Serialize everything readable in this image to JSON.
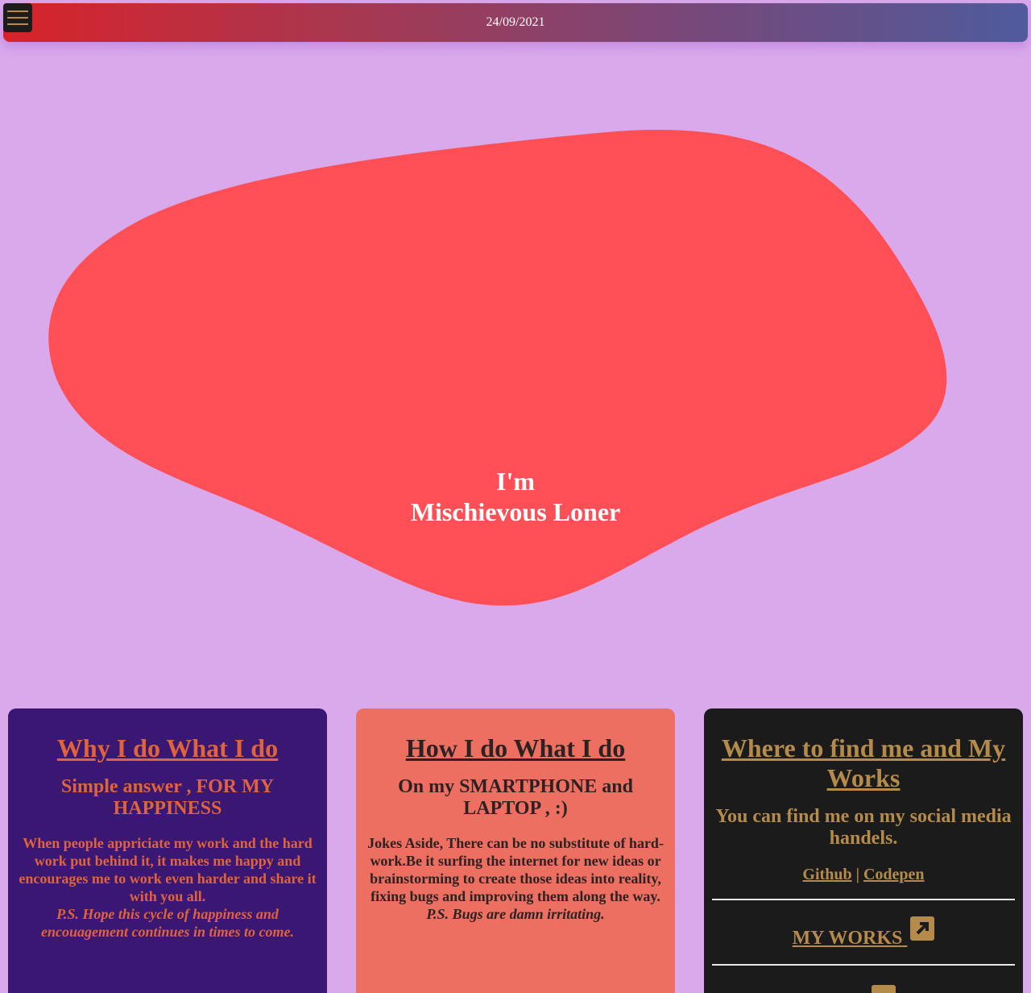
{
  "header": {
    "date": "24/09/2021",
    "menu_icon": "hamburger-menu-icon"
  },
  "hero": {
    "line1": "I'm",
    "line2": "Mischievous Loner",
    "blob_color": "#fe4f56"
  },
  "cards": {
    "why": {
      "title": "Why I do What I do",
      "subtitle": "Simple answer , FOR MY HAPPINESS",
      "body": "When people appriciate my work and the hard work put behind it, it makes me happy and encourages me to work even harder and share it with you all.",
      "ps": "P.S. Hope this cycle of happiness and encouagement continues in times to come."
    },
    "how": {
      "title": "How I do What I do",
      "subtitle": "On my SMARTPHONE and LAPTOP , :)",
      "body": "Jokes Aside, There can be no substitute of hard-work.Be it surfing the internet for new ideas or brainstorming to create those ideas into reality, fixing bugs and improving them along the way.",
      "ps": "P.S. Bugs are damn irritating."
    },
    "where": {
      "title": "Where to find me and My Works",
      "subtitle": "You can find me on my social media handels.",
      "link_github": "Github",
      "separator": "|",
      "link_codepen": "Codepen",
      "my_works": "MY WORKS",
      "icon": "external-link-icon"
    }
  },
  "colors": {
    "background": "#d9a9eb",
    "accent_gold": "#b58b4b"
  }
}
